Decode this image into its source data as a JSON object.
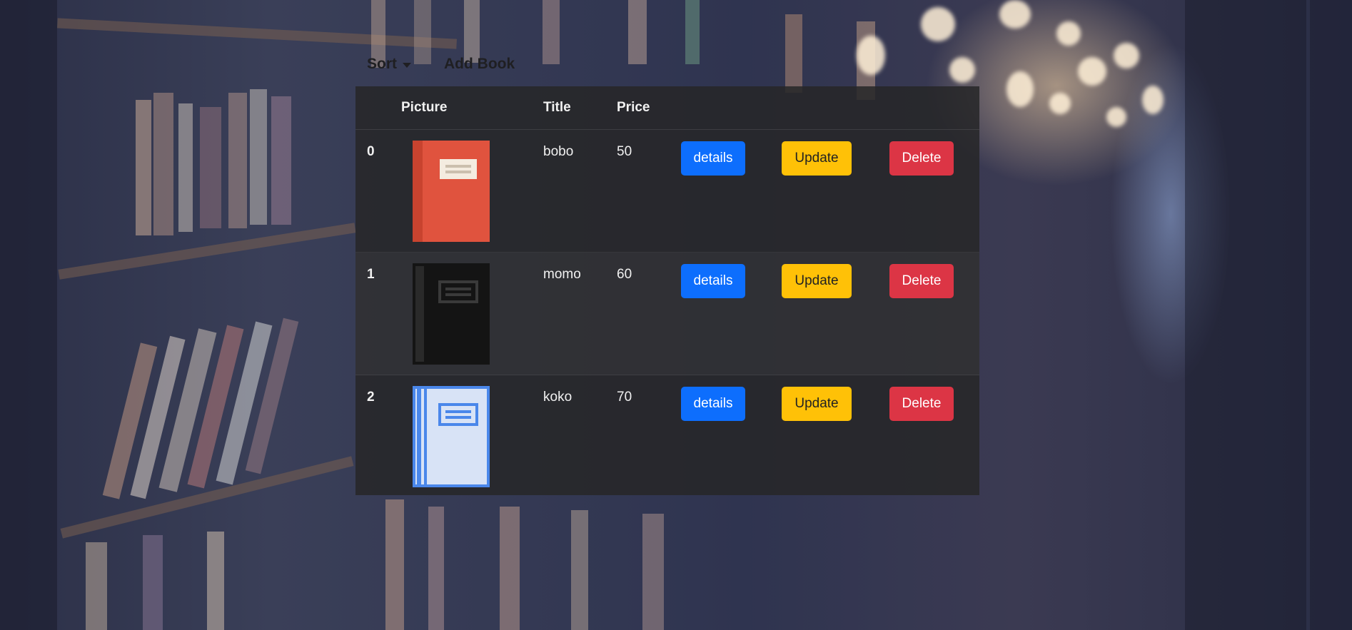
{
  "nav": {
    "sort_label": "Sort",
    "add_book_label": "Add Book"
  },
  "table": {
    "headers": [
      "",
      "Picture",
      "Title",
      "Price",
      "",
      "",
      ""
    ],
    "rows": [
      {
        "index": "0",
        "title": "bobo",
        "price": "50",
        "cover_icon": "red-book-icon",
        "cover_color": "#e0533e"
      },
      {
        "index": "1",
        "title": "momo",
        "price": "60",
        "cover_icon": "black-book-icon",
        "cover_color": "#141414"
      },
      {
        "index": "2",
        "title": "koko",
        "price": "70",
        "cover_icon": "blue-book-icon",
        "cover_color": "#d8e3f6"
      }
    ],
    "buttons": {
      "details": "details",
      "update": "Update",
      "delete": "Delete"
    }
  },
  "colors": {
    "details": "#0d6efd",
    "update": "#ffc107",
    "delete": "#dc3545"
  }
}
